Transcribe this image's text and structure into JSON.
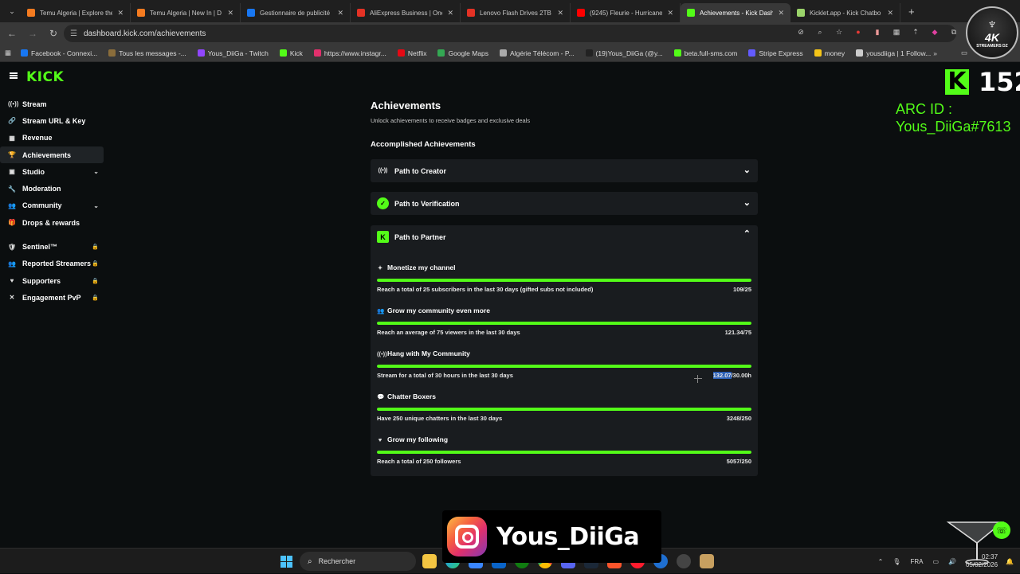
{
  "browser": {
    "tabs": [
      {
        "label": "Temu Algeria | Explore the",
        "color": "#f47b20",
        "active": false
      },
      {
        "label": "Temu Algeria | New In | D",
        "color": "#f47b20",
        "active": false
      },
      {
        "label": "Gestionnaire de publicité",
        "color": "#1877f2",
        "active": false
      },
      {
        "label": "AliExpress Business | One",
        "color": "#e43225",
        "active": false
      },
      {
        "label": "Lenovo Flash Drives 2TB U",
        "color": "#e43225",
        "active": false
      },
      {
        "label": "(9245) Fleurie - Hurricane",
        "color": "#ff0000",
        "active": false
      },
      {
        "label": "Achievements - Kick Dash",
        "color": "#53fc18",
        "active": true
      },
      {
        "label": "Kicklet.app - Kick Chatbo",
        "color": "#9ad36a",
        "active": false
      }
    ],
    "url": "dashboard.kick.com/achievements",
    "bookmarks": [
      {
        "label": "Facebook - Connexi...",
        "color": "#1877f2"
      },
      {
        "label": "Tous les messages -...",
        "color": "#8a6d3b"
      },
      {
        "label": "Yous_DiiGa - Twitch",
        "color": "#9146ff"
      },
      {
        "label": "Kick",
        "color": "#53fc18"
      },
      {
        "label": "https://www.instagr...",
        "color": "#e1306c"
      },
      {
        "label": "Netflix",
        "color": "#e50914"
      },
      {
        "label": "Google Maps",
        "color": "#34a853"
      },
      {
        "label": "Algérie Télécom - P...",
        "color": "#aaaaaa"
      },
      {
        "label": "(19)Yous_DiiGa (@y...",
        "color": "#222222"
      },
      {
        "label": "beta.full-sms.com",
        "color": "#53fc18"
      },
      {
        "label": "Stripe Express",
        "color": "#635bff"
      },
      {
        "label": "money",
        "color": "#f5c518"
      },
      {
        "label": "yousdiiga | 1 Follow...",
        "color": "#cccccc"
      }
    ],
    "profile_badge": {
      "text": "4K",
      "sub": "STREAMERS DZ"
    }
  },
  "app": {
    "logo": "KICK",
    "sidebar": {
      "items": [
        {
          "label": "Stream",
          "icon": "((•))",
          "chevron": false,
          "lock": false,
          "active": false
        },
        {
          "label": "Stream URL & Key",
          "icon": "🔗",
          "chevron": false,
          "lock": false,
          "active": false
        },
        {
          "label": "Revenue",
          "icon": "▦",
          "chevron": false,
          "lock": false,
          "active": false
        },
        {
          "label": "Achievements",
          "icon": "🏆",
          "chevron": false,
          "lock": false,
          "active": true
        },
        {
          "label": "Studio",
          "icon": "▣",
          "chevron": true,
          "lock": false,
          "active": false
        },
        {
          "label": "Moderation",
          "icon": "🔧",
          "chevron": false,
          "lock": false,
          "active": false
        },
        {
          "label": "Community",
          "icon": "👥",
          "chevron": true,
          "lock": false,
          "active": false
        },
        {
          "label": "Drops & rewards",
          "icon": "🎁",
          "chevron": false,
          "lock": false,
          "active": false
        }
      ],
      "locked_items": [
        {
          "label": "Sentinel™",
          "icon": "🛡"
        },
        {
          "label": "Reported Streamers",
          "icon": "👥"
        },
        {
          "label": "Supporters",
          "icon": "♥"
        },
        {
          "label": "Engagement PvP",
          "icon": "✕"
        }
      ]
    },
    "page_title": "Achievements",
    "page_subtitle": "Unlock achievements to receive badges and exclusive deals",
    "section_title": "Accomplished Achievements",
    "panels": [
      {
        "label": "Path to Creator",
        "expanded": false
      },
      {
        "label": "Path to Verification",
        "expanded": false
      },
      {
        "label": "Path to Partner",
        "expanded": true
      }
    ],
    "goals": [
      {
        "title": "Monetize my channel",
        "icon": "✦",
        "desc": "Reach a total of 25 subscribers in the last 30 days (gifted subs not included)",
        "value": "109/25",
        "progress": 1.0
      },
      {
        "title": "Grow my community even more",
        "icon": "👥",
        "desc": "Reach an average of 75 viewers in the last 30 days",
        "value": "121.34/75",
        "progress": 1.0
      },
      {
        "title": "Hang with My Community",
        "icon": "((•))",
        "desc": "Stream for a total of 30 hours in the last 30 days",
        "value_selected": "132.07",
        "value": "/30.00h",
        "progress": 1.0
      },
      {
        "title": "Chatter Boxers",
        "icon": "💬",
        "desc": "Have 250 unique chatters in the last 30 days",
        "value": "3248/250",
        "progress": 1.0
      },
      {
        "title": "Grow my following",
        "icon": "♥",
        "desc": "Reach a total of 250 followers",
        "value": "5057/250",
        "progress": 1.0
      }
    ]
  },
  "overlay": {
    "kick_count": "152",
    "arc_label": "ARC ID :",
    "arc_id": "Yous_DiiGa#7613",
    "ig_name": "Yous_DiiGa"
  },
  "taskbar": {
    "search_placeholder": "Rechercher",
    "lang": "FRA",
    "time": "02:37",
    "date": "05/02/2026"
  }
}
